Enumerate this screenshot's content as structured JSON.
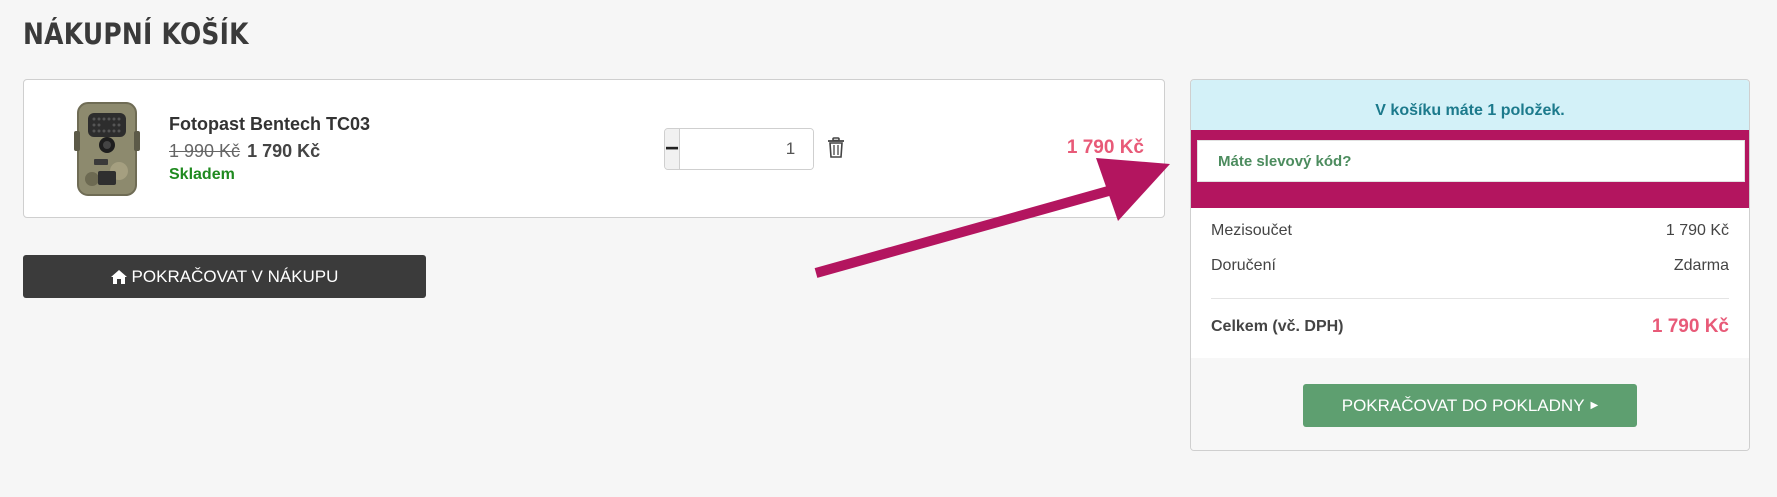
{
  "page_title": "NÁKUPNÍ KOŠÍK",
  "cart_item": {
    "name": "Fotopast Bentech TC03",
    "old_price": "1 990 Kč",
    "price": "1 790 Kč",
    "stock": "Skladem",
    "quantity": "1",
    "minus_label": "−",
    "plus_label": "+",
    "total": "1 790 Kč"
  },
  "continue_shopping": {
    "label": "POKRAČOVAT V NÁKUPU",
    "icon": "home-icon"
  },
  "summary": {
    "items_count_text": "V košíku máte 1 položek.",
    "discount_link": "Máte slevový kód?",
    "subtotal_label": "Mezisoučet",
    "subtotal_value": "1 790 Kč",
    "delivery_label": "Doručení",
    "delivery_value": "Zdarma",
    "total_label": "Celkem (vč. DPH)",
    "total_value": "1 790 Kč",
    "checkout_label": "POKRAČOVAT DO POKLADNY",
    "checkout_icon": "caret-right-icon"
  },
  "colors": {
    "accent_price": "#e85a78",
    "checkout_green": "#5e9f70",
    "in_stock_green": "#1f8a1f",
    "highlight_magenta": "#b3155f",
    "info_bg": "#d3f1f8"
  }
}
